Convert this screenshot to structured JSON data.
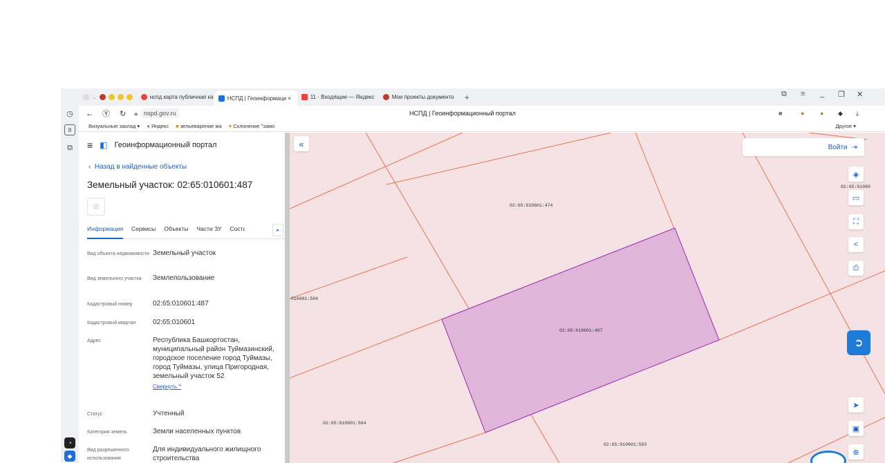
{
  "browser": {
    "tabs": [
      {
        "label": "нспд карта публичная ка"
      },
      {
        "label": "НСПД | Геоинформаци ×"
      },
      {
        "label": "11 · Входящие — Яндекс"
      },
      {
        "label": "Мои проекты документо"
      }
    ],
    "tab_new": "+",
    "tab_counter": "8",
    "address": "nspd.gov.ru",
    "page_title": "НСПД | Геоинформационный портал",
    "bookmarks": [
      "Визуальные заклад ▾",
      "Яндекс",
      "зельеварение ма",
      "Склонение \"замо"
    ],
    "other_bookmarks": "Другое ▾"
  },
  "portal": {
    "name": "Геоинформационный портал",
    "back_link": "Назад в найденные объекты",
    "title": "Земельный участок: 02:65:010601:487",
    "tabs": [
      "Информация",
      "Сервисы",
      "Объекты",
      "Части ЗУ",
      "Состав"
    ],
    "fields": [
      {
        "label": "Вид объекта недвижимости",
        "value": "Земельный участок"
      },
      {
        "label": "Вид земельного участка",
        "value": "Землепользование"
      },
      {
        "label": "Кадастровый номер",
        "value": "02:65:010601:487"
      },
      {
        "label": "Кадастровый квартал",
        "value": "02:65:010601"
      },
      {
        "label": "Адрес",
        "value": "Республика Башкортостан, муниципальный район Туймазинский, городское поселение город Туймазы, город Туймазы, улица Пригородная, земельный участок 52"
      },
      {
        "label": "Статус",
        "value": "Учтенный"
      },
      {
        "label": "Категория земель",
        "value": "Земли населенных пунктов"
      },
      {
        "label": "Вид разрешенного использования",
        "value": "Для индивидуального жилищного строительства"
      }
    ],
    "collapse_link": "Свернуть ^"
  },
  "map": {
    "login": "Войти",
    "parcel_labels": [
      "02:65:010601:474",
      "02:65:010601:487",
      "02:65:010601:564",
      "02:65:010601:503",
      "010601:504",
      "02:65:01060"
    ],
    "colors": {
      "background": "#f5e2e4",
      "boundary": "#e8734f",
      "selected_fill": "#dfb6d9",
      "selected_stroke": "#9b27b0"
    }
  }
}
